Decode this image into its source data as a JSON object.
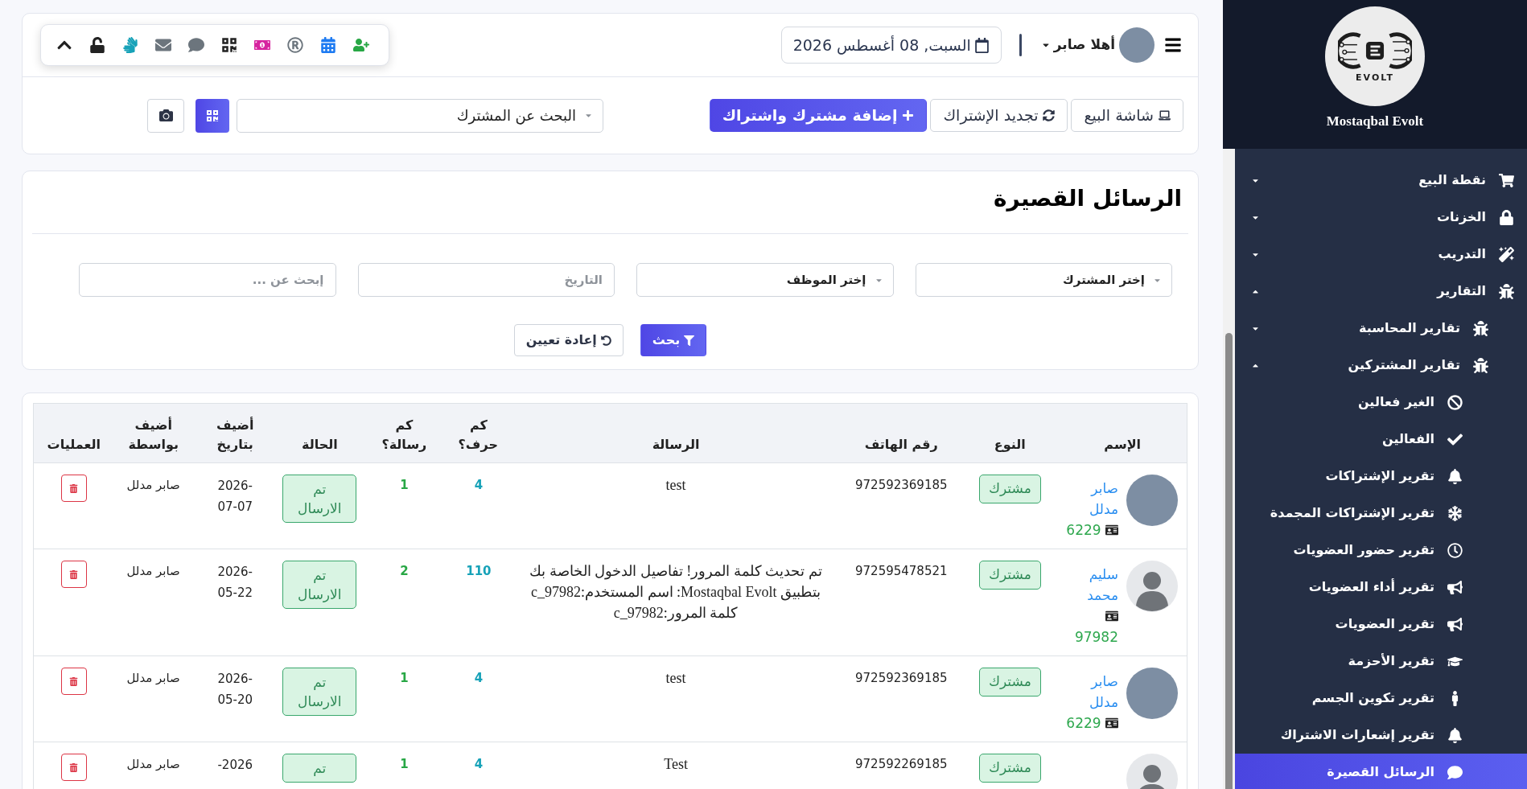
{
  "header": {
    "greeting": "أهلا صابر",
    "date": "السبت, 08 أغسطس 2026"
  },
  "actions": {
    "buttons": [
      {
        "label": "شاشة البيع",
        "kind": "outline"
      },
      {
        "label": "تجديد الإشتراك",
        "kind": "outline"
      },
      {
        "label": "إضافة مشترك واشتراك",
        "kind": "primary"
      }
    ],
    "subscriber_search": {
      "placeholder": "البحث عن المشترك"
    }
  },
  "page_title": "الرسائل القصيرة",
  "filters": [
    {
      "kind": "select",
      "placeholder": "إختر المشترك"
    },
    {
      "kind": "select",
      "placeholder": "إختر الموظف"
    },
    {
      "kind": "date",
      "placeholder": "التاريخ"
    },
    {
      "kind": "text",
      "placeholder": "إبحث عن ..."
    }
  ],
  "filter_buttons": [
    {
      "label": "بحث",
      "kind": "primary"
    },
    {
      "label": "إعادة تعيين",
      "kind": "outline"
    }
  ],
  "table": {
    "columns": [
      "الإسم",
      "النوع",
      "رقم الهاتف",
      "الرسالة",
      "كم حرف؟",
      "كم رسالة؟",
      "الحالة",
      "أضيف بتاريخ",
      "أضيف بواسطة",
      "العمليات"
    ],
    "rows": [
      {
        "avatar": {
          "kind": "photo"
        },
        "name": "صابر مدلل",
        "member_id": "6229",
        "type": "مشترك",
        "phone": "972592369185",
        "message": "test",
        "chars": "4",
        "parts": "1",
        "status": "تم الارسال",
        "date": "2026-07-07",
        "added_by": "صابر مدلل"
      },
      {
        "avatar": {
          "kind": "silhouette"
        },
        "name": "سليم محمد",
        "member_id": "97982",
        "type": "مشترك",
        "phone": "972595478521",
        "message": "تم تحديث كلمة المرور! تفاصيل الدخول الخاصة بك بتطبيق Mostaqbal Evolt: اسم المستخدم:c_97982 كلمة المرور:c_97982",
        "chars": "110",
        "parts": "2",
        "status": "تم الارسال",
        "date": "2026-05-22",
        "added_by": "صابر مدلل"
      },
      {
        "avatar": {
          "kind": "photo"
        },
        "name": "صابر مدلل",
        "member_id": "6229",
        "type": "مشترك",
        "phone": "972592369185",
        "message": "test",
        "chars": "4",
        "parts": "1",
        "status": "تم الارسال",
        "date": "2026-05-20",
        "added_by": "صابر مدلل"
      },
      {
        "avatar": {
          "kind": "silhouette"
        },
        "type": "مشترك",
        "phone": "972592269185",
        "message": "Test",
        "chars": "4",
        "parts": "1",
        "status": "تم",
        "date": "2026-",
        "added_by": "صابر مدلل"
      }
    ]
  },
  "sidebar": {
    "logo_text": "EVOLT",
    "brand": "Mostaqbal Evolt",
    "items": [
      {
        "label": "نقطة البيع",
        "expanded": false,
        "selected": false
      },
      {
        "label": "الخزنات",
        "expanded": false,
        "selected": false
      },
      {
        "label": "التدريب",
        "expanded": false,
        "selected": false
      },
      {
        "label": "التقارير",
        "expanded": true,
        "selected": false,
        "children": [
          {
            "label": "تقارير المحاسبة",
            "expanded": false,
            "selected": false
          },
          {
            "label": "تقارير المشتركين",
            "expanded": true,
            "selected": false,
            "children": [
              {
                "label": "الغير فعالين",
                "selected": false
              },
              {
                "label": "الفعالين",
                "selected": false
              },
              {
                "label": "تقرير الإشتراكات",
                "selected": false
              },
              {
                "label": "تقرير الإشتراكات المجمدة",
                "selected": false
              },
              {
                "label": "تقرير حضور العضويات",
                "selected": false
              },
              {
                "label": "تقرير أداء العضويات",
                "selected": false
              },
              {
                "label": "تقرير العضويات",
                "selected": false
              },
              {
                "label": "تقرير الأحزمة",
                "selected": false
              },
              {
                "label": "تقرير تكوين الجسم",
                "selected": false
              },
              {
                "label": "تقرير إشعارات الاشتراك",
                "selected": false
              },
              {
                "label": "الرسائل القصيرة",
                "selected": true
              }
            ]
          }
        ]
      }
    ]
  }
}
